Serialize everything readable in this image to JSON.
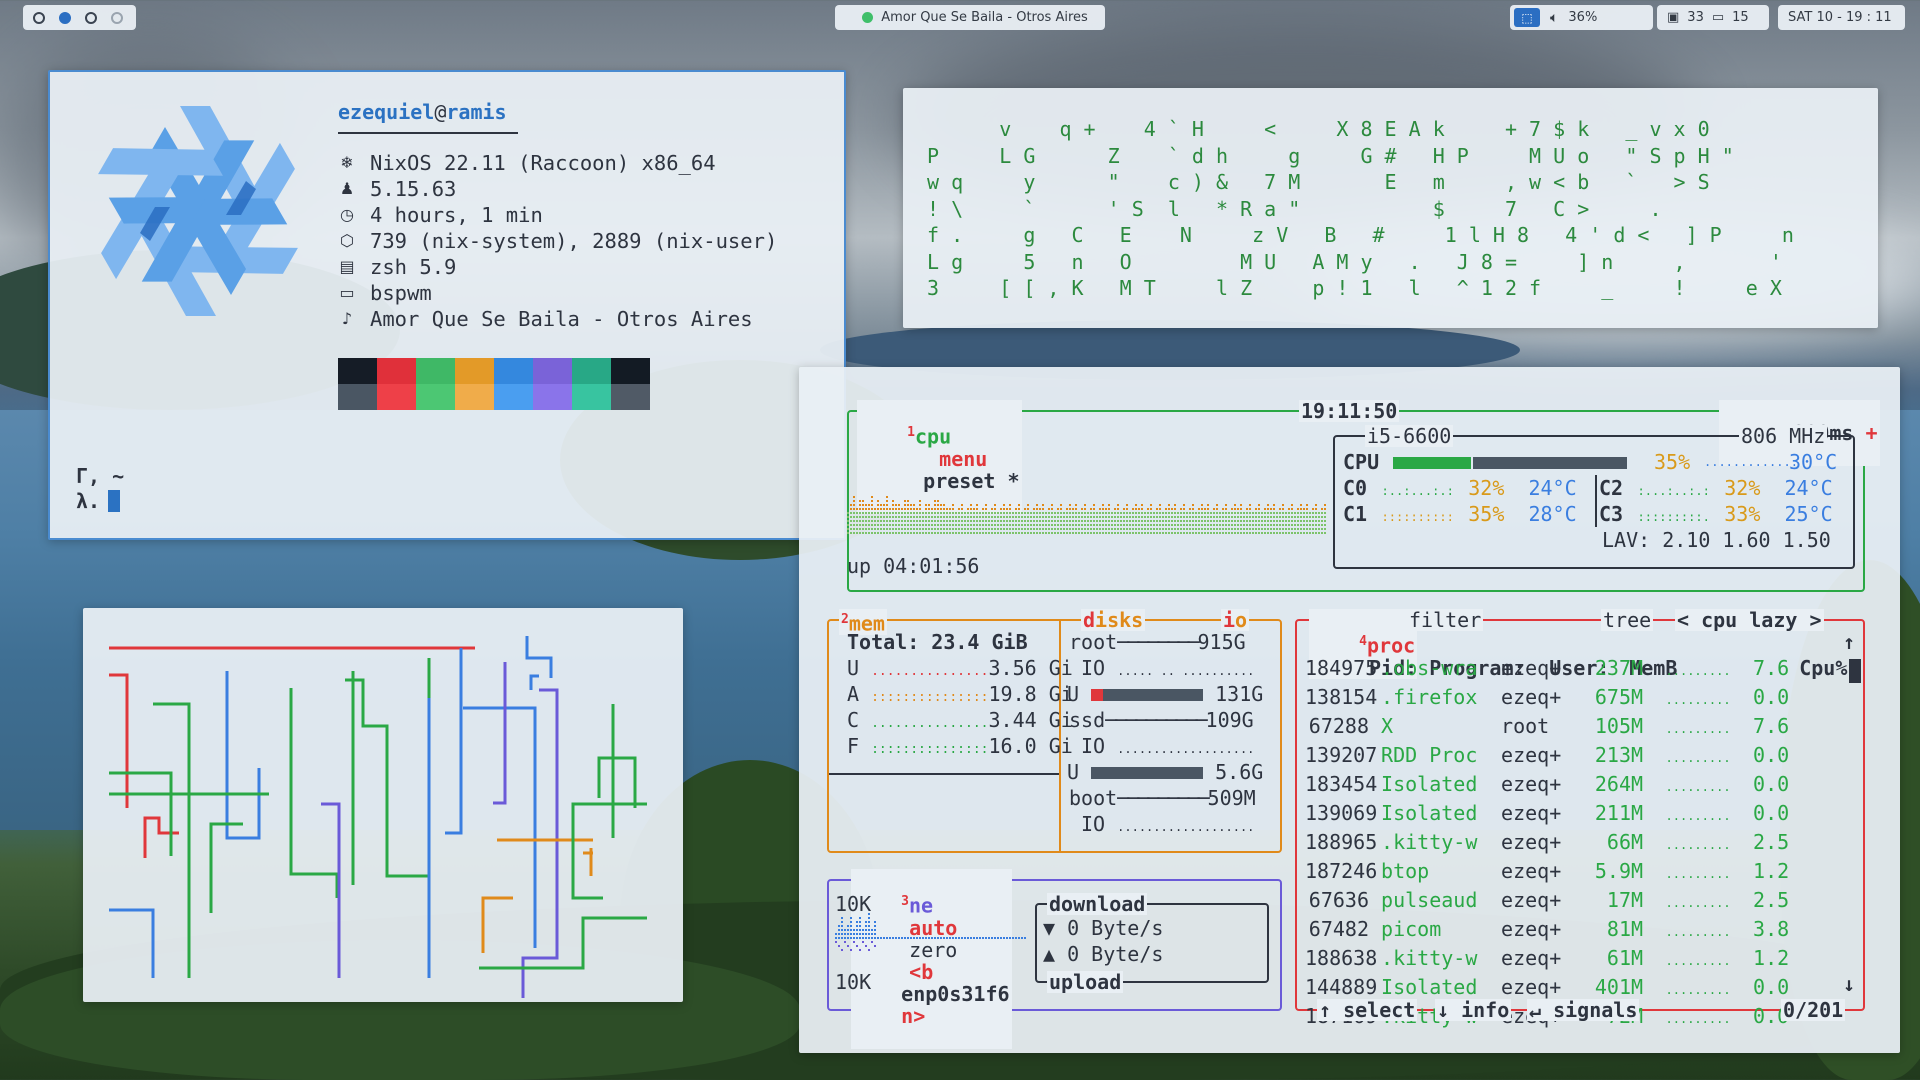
{
  "topbar": {
    "workspaces": [
      "ws1",
      "ws2",
      "ws3",
      "ws4"
    ],
    "active_window_title": "Amor Que Se Baila - Otros Aires",
    "keyboard_layout": "🔒",
    "volume": "36%",
    "cpu_temp_label": "33",
    "windows_count": "15",
    "datetime": "SAT 10  -  19 : 11"
  },
  "fetch": {
    "user": "ezequiel",
    "host": "ramis",
    "rows": [
      {
        "icon": "snowflake-icon",
        "text": "NixOS 22.11 (Raccoon) x86_64"
      },
      {
        "icon": "linux-icon",
        "text": "5.15.63"
      },
      {
        "icon": "clock-icon",
        "text": "4 hours, 1 min"
      },
      {
        "icon": "package-icon",
        "text": "739 (nix-system), 2889 (nix-user)"
      },
      {
        "icon": "terminal-icon",
        "text": "zsh 5.9"
      },
      {
        "icon": "window-icon",
        "text": "bspwm"
      },
      {
        "icon": "music-note-icon",
        "text": "Amor Que Se Baila - Otros Aires"
      }
    ],
    "palette_dark": [
      "#151c26",
      "#e0303a",
      "#3fb866",
      "#e39a28",
      "#3488de",
      "#7a63d8",
      "#28a886",
      "#131b24"
    ],
    "palette_light": [
      "#4a5663",
      "#ee4048",
      "#4cc773",
      "#f0ac4a",
      "#4a9ef0",
      "#8a74ea",
      "#38c4a0",
      "#505a66"
    ],
    "prompt_line1": "Γ, ~",
    "prompt_line2": "λ."
  },
  "matrix": {
    "rows": [
      "      v    q +    4 ` H     <     X 8 E A k     + 7 $ k   _ v x 0",
      "P     L G      Z    ` d h     g     G #   H P     M U o   \" S p H \"",
      "w q     y      \"    c ) &   7 M       E   m     , w < b   `   > S",
      "! \\     `      ' S  l   * R a \"           $     7   C >     .",
      "f .     g   C   E    N     z V   B   #     1 l H 8   4 ' d <   ] P     n",
      "L g     5   n   O         M U   A M y   .   J 8 =     ] n     ,       '",
      "3     [ [ , K   M T     l Z     p ! 1   l   ^ 1 2 f     _     !     e X"
    ]
  },
  "btop": {
    "cpu_box": {
      "tab_num": "1",
      "tab_cpu": "cpu",
      "menu": "menu",
      "preset": "preset *",
      "clock": "19:11:50",
      "interval": "200ms",
      "minus": "-",
      "plus": "+",
      "uptime": "up 04:01:56",
      "cpu_model": "i5-6600",
      "freq": "806 MHz",
      "cpu_label": "CPU",
      "cpu_pct": "35%",
      "cpu_temp": "30°C",
      "cores": [
        {
          "name": "C0",
          "pct": "32%",
          "temp": "24°C"
        },
        {
          "name": "C1",
          "pct": "35%",
          "temp": "28°C"
        },
        {
          "name": "C2",
          "pct": "32%",
          "temp": "24°C"
        },
        {
          "name": "C3",
          "pct": "33%",
          "temp": "25°C"
        }
      ],
      "lav": "LAV: 2.10 1.60 1.50"
    },
    "mem_box": {
      "tab_num": "2",
      "tab_mem": "mem",
      "disks": "disks",
      "io": "io",
      "total": "Total: 23.4 GiB",
      "rows": [
        {
          "k": "U",
          "v": "3.56 Gi",
          "color": "red"
        },
        {
          "k": "A",
          "v": "19.8 Gi",
          "color": "orange"
        },
        {
          "k": "C",
          "v": "3.44 Gi",
          "color": "green"
        },
        {
          "k": "F",
          "v": "16.0 Gi",
          "color": "green"
        }
      ],
      "disk_root": "root",
      "disk_root_size": "915G",
      "disk_io": "IO",
      "disk_root_used": "131G",
      "disk_ssd": "ssd",
      "disk_ssd_size": "109G",
      "disk_ssd_used": "5.6G",
      "disk_boot": "boot",
      "disk_boot_size": "509M",
      "u_label": "U"
    },
    "net_box": {
      "tab_num": "3",
      "tab_net": "ne",
      "auto": "auto",
      "zero": "zero",
      "b": "<b",
      "iface": "enp0s31f6",
      "n": "n>",
      "top_scale": "10K",
      "bottom_scale": "10K",
      "download": "download",
      "dl_rate": "▼ 0 Byte/s",
      "ul_rate": "▲ 0 Byte/s",
      "upload": "upload"
    },
    "proc_box": {
      "tab_num": "4",
      "tab_proc": "proc",
      "filter": "filter",
      "tree": "tree",
      "cpu_lazy": "< cpu lazy >",
      "headers": [
        "Pid:",
        "Program:",
        "User:",
        "MemB",
        "Cpu%"
      ],
      "rows": [
        {
          "pid": "184975",
          "prog": ".obs-wra",
          "user": "ezeq+",
          "mem": "237M",
          "cpu": "7.6"
        },
        {
          "pid": "138154",
          "prog": ".firefox",
          "user": "ezeq+",
          "mem": "675M",
          "cpu": "0.0"
        },
        {
          "pid": "67288",
          "prog": "X",
          "user": "root",
          "mem": "105M",
          "cpu": "7.6"
        },
        {
          "pid": "139207",
          "prog": "RDD Proc",
          "user": "ezeq+",
          "mem": "213M",
          "cpu": "0.0"
        },
        {
          "pid": "183454",
          "prog": "Isolated",
          "user": "ezeq+",
          "mem": "264M",
          "cpu": "0.0"
        },
        {
          "pid": "139069",
          "prog": "Isolated",
          "user": "ezeq+",
          "mem": "211M",
          "cpu": "0.0"
        },
        {
          "pid": "188965",
          "prog": ".kitty-w",
          "user": "ezeq+",
          "mem": "66M",
          "cpu": "2.5"
        },
        {
          "pid": "187246",
          "prog": "btop",
          "user": "ezeq+",
          "mem": "5.9M",
          "cpu": "1.2"
        },
        {
          "pid": "67636",
          "prog": "pulseaud",
          "user": "ezeq+",
          "mem": "17M",
          "cpu": "2.5"
        },
        {
          "pid": "67482",
          "prog": "picom",
          "user": "ezeq+",
          "mem": "81M",
          "cpu": "3.8"
        },
        {
          "pid": "188638",
          "prog": ".kitty-w",
          "user": "ezeq+",
          "mem": "61M",
          "cpu": "1.2"
        },
        {
          "pid": "144889",
          "prog": "Isolated",
          "user": "ezeq+",
          "mem": "401M",
          "cpu": "0.0"
        },
        {
          "pid": "187169",
          "prog": ".kitty-w",
          "user": "ezeq+",
          "mem": "72M",
          "cpu": "0.0"
        }
      ],
      "select": "↑ select",
      "info": "↓ info",
      "signals": "↵ signals",
      "count": "0/201"
    }
  }
}
